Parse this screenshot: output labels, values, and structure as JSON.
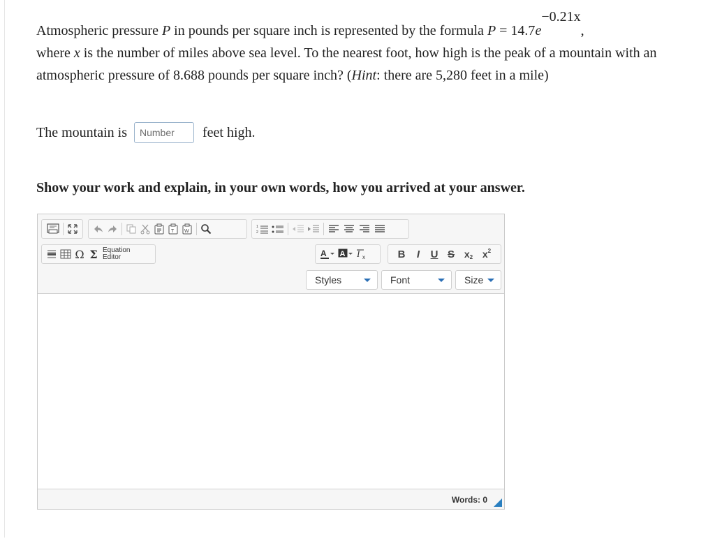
{
  "question": {
    "t1": "Atmospheric pressure ",
    "v_P": "P",
    "t2": " in pounds per square inch is represented by the formula ",
    "formula_lhs": "P",
    "formula_eq": " = 14.7",
    "formula_e": "e",
    "formula_exp": "−0.21x",
    "t3": ",",
    "t4": "where ",
    "v_x": "x",
    "t5": " is the number of miles above sea level. To the nearest foot, how high is the peak of a mountain with an atmospheric pressure of 8.688 pounds per square inch? (",
    "hint_label": "Hint",
    "t6": ": there are 5,280 feet in a mile)"
  },
  "answer": {
    "prefix": "The mountain is",
    "placeholder": "Number",
    "value": "",
    "suffix": "feet high."
  },
  "instruction": "Show your work and explain, in your own words, how you arrived at your answer.",
  "editor": {
    "equation_editor_line1": "Equation",
    "equation_editor_line2": "Editor",
    "styles_label": "Styles",
    "font_label": "Font",
    "size_label": "Size",
    "words_label": "Words: 0",
    "accent_color": "#2a7fc0"
  },
  "icons": [
    "source-icon",
    "maximize-icon",
    "undo-icon",
    "redo-icon",
    "copy-icon",
    "cut-icon",
    "paste-icon",
    "paste-text-icon",
    "paste-word-icon",
    "find-icon",
    "numbered-list-icon",
    "bulleted-list-icon",
    "outdent-icon",
    "indent-icon",
    "align-left-icon",
    "align-center-icon",
    "align-right-icon",
    "align-justify-icon",
    "horizontal-rule-icon",
    "table-icon",
    "omega-icon",
    "sigma-icon",
    "text-color-icon",
    "background-color-icon",
    "remove-format-icon",
    "bold-icon",
    "italic-icon",
    "underline-icon",
    "strikethrough-icon",
    "subscript-icon",
    "superscript-icon"
  ]
}
